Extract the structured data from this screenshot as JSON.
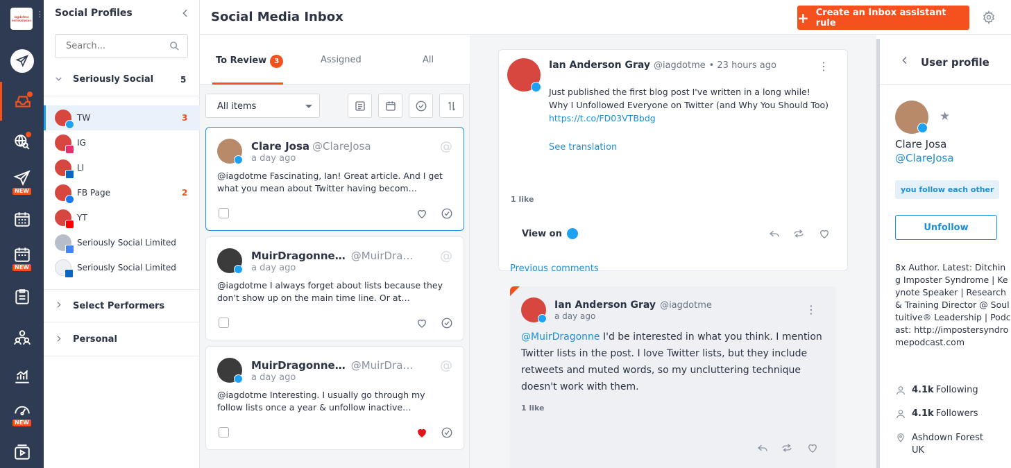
{
  "header": {
    "title": "Social Media Inbox",
    "create_rule_label": "Create an Inbox assistant rule"
  },
  "rail": {
    "logo_text": "iagdotme seriouslysocial",
    "new_badge": "NEW"
  },
  "profiles_panel": {
    "title": "Social Profiles",
    "search_placeholder": "Search...",
    "groups": [
      {
        "name": "Seriously Social",
        "count": "5"
      },
      {
        "name": "Select Performers"
      },
      {
        "name": "Personal"
      }
    ],
    "profiles": [
      {
        "name": "TW",
        "count": "3",
        "network": "twitter"
      },
      {
        "name": "IG",
        "network": "instagram"
      },
      {
        "name": "LI",
        "network": "linkedin"
      },
      {
        "name": "FB Page",
        "count": "2",
        "network": "facebook"
      },
      {
        "name": "YT",
        "network": "youtube"
      },
      {
        "name": "Seriously Social Limited",
        "network": "google"
      },
      {
        "name": "Seriously Social Limited",
        "network": "linkedin"
      }
    ]
  },
  "inbox": {
    "tabs": [
      {
        "label": "To Review",
        "badge": "3"
      },
      {
        "label": "Assigned"
      },
      {
        "label": "All"
      }
    ],
    "filter_value": "All items",
    "cards": [
      {
        "name": "Clare Josa",
        "handle": "@ClareJosa",
        "time": "a day ago",
        "text": "@iagdotme Fascinating, Ian! Great article. And I get what you mean about Twitter having becom…",
        "liked": false
      },
      {
        "name": "MuirDragonne…",
        "handle": "@MuirDra…",
        "time": "a day ago",
        "text": "@iagdotme I always forget about lists because they don't show up on the main time line. Or at…",
        "liked": false
      },
      {
        "name": "MuirDragonne…",
        "handle": "@MuirDra…",
        "time": "a day ago",
        "text": "@iagdotme Interesting. I usually go through my follow lists once a year & unfollow inactive…",
        "liked": true
      }
    ]
  },
  "conversation": {
    "post": {
      "name": "Ian Anderson Gray",
      "handle": "@iagdotme",
      "time": "• 23 hours ago",
      "line1": "Just published the first blog post I've written in a long while!",
      "line2": "Why I Unfollowed Everyone on Twitter (and Why You Should Too)",
      "link": "https://t.co/FD03VTBbdg",
      "see_translation": "See translation",
      "likes": "1 like",
      "view_on": "View on"
    },
    "previous_comments": "Previous comments",
    "comment": {
      "name": "Ian Anderson Gray",
      "handle": "@iagdotme",
      "time": "a day ago",
      "mention": "@MuirDragonne",
      "text": " I'd be interested in what you think. I mention Twitter lists in the post. I love Twitter lists, but they include retweets and muted words, so my uncluttering technique doesn't work with them.",
      "likes": "1 like"
    }
  },
  "user_profile": {
    "title": "User profile",
    "name": "Clare Josa",
    "handle": "@ClareJosa",
    "follow_status": "you follow each other",
    "unfollow_label": "Unfollow",
    "bio": "8x Author. Latest: Ditching Imposter Syndrome | Keynote Speaker | Research & Training Director @ Soultuitive® Leadership | Podcast: http://impostersyndromepodcast.com",
    "following_count": "4.1k",
    "following_label": "Following",
    "followers_count": "4.1k",
    "followers_label": "Followers",
    "location_line1": "Ashdown Forest",
    "location_line2": "UK"
  },
  "colors": {
    "accent": "#f4511e",
    "rail": "#2f3b52",
    "link": "#1d8fd6",
    "twitter": "#1da1f2"
  }
}
